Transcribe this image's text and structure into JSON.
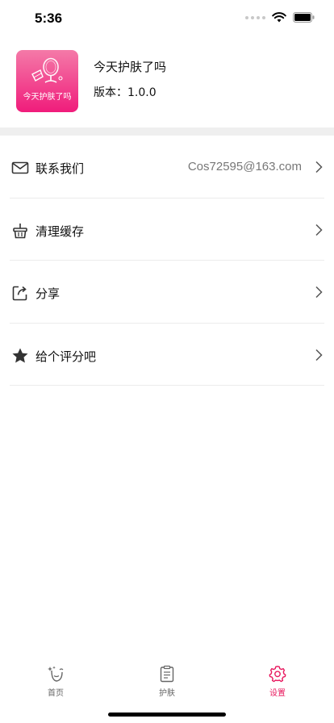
{
  "status": {
    "time": "5:36"
  },
  "app": {
    "icon_text": "今天护肤了吗",
    "name": "今天护肤了吗",
    "version": "版本：1.0.0"
  },
  "menu": {
    "items": [
      {
        "label": "联系我们",
        "value": "Cos72595@163.com",
        "icon": "mail-icon"
      },
      {
        "label": "清理缓存",
        "value": "",
        "icon": "broom-basket-icon"
      },
      {
        "label": "分享",
        "value": "",
        "icon": "share-icon"
      },
      {
        "label": "给个评分吧",
        "value": "",
        "icon": "star-icon"
      }
    ]
  },
  "tabbar": {
    "tabs": [
      {
        "label": "首页",
        "icon": "face-sparkle-icon",
        "active": false
      },
      {
        "label": "护肤",
        "icon": "clipboard-icon",
        "active": false
      },
      {
        "label": "设置",
        "icon": "gear-icon",
        "active": true
      }
    ],
    "active_color": "#e8185e"
  },
  "colors": {
    "icon_gradient_top": "#f47aa8",
    "icon_gradient_bottom": "#f01c7b"
  }
}
